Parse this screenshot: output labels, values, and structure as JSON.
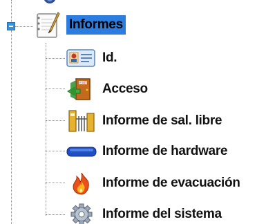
{
  "tree": {
    "root": {
      "label": "Informes",
      "icon": "report-notebook-icon",
      "expanded": true,
      "selected": true,
      "children": [
        {
          "label": "Id.",
          "icon": "id-card-icon"
        },
        {
          "label": "Acceso",
          "icon": "exit-door-icon"
        },
        {
          "label": "Informe de sal. libre",
          "icon": "gate-icon"
        },
        {
          "label": "Informe de hardware",
          "icon": "hardware-device-icon"
        },
        {
          "label": "Informe de evacuación",
          "icon": "fire-icon"
        },
        {
          "label": "Informe del sistema",
          "icon": "gear-icon"
        }
      ]
    },
    "colors": {
      "selection": "#2b7de0",
      "expander": "#3a8fd9",
      "connector": "#8a8a8a"
    }
  }
}
